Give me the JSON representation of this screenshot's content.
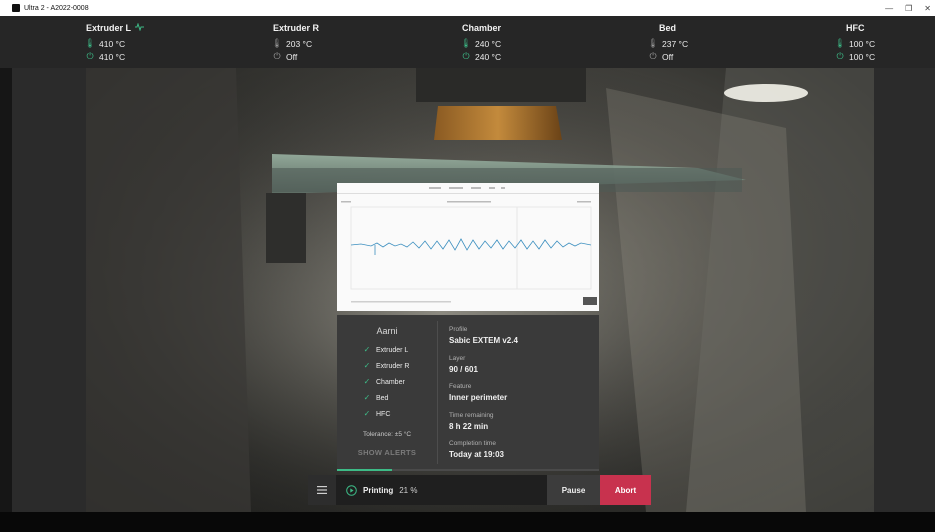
{
  "window": {
    "title": "Ultra 2 - A2022-0008",
    "controls": [
      "—",
      "❐",
      "✕"
    ]
  },
  "temps": [
    {
      "name": "Extruder L",
      "current": "410 °C",
      "target": "410 °C",
      "badge_icon": "pulse-icon"
    },
    {
      "name": "Extruder R",
      "current": "203 °C",
      "target": "Off"
    },
    {
      "name": "Chamber",
      "current": "240 °C",
      "target": "240 °C"
    },
    {
      "name": "Bed",
      "current": "237 °C",
      "target": "Off"
    },
    {
      "name": "HFC",
      "current": "100 °C",
      "target": "100 °C"
    }
  ],
  "panel": {
    "title": "Aarni",
    "checks": [
      "Extruder L",
      "Extruder R",
      "Chamber",
      "Bed",
      "HFC"
    ],
    "tolerance": "Tolerance: ±5 °C",
    "show_alerts": "SHOW ALERTS",
    "profile_label": "Profile",
    "profile_value": "Sabic EXTEM v2.4",
    "layer_label": "Layer",
    "layer_value": "90 / 601",
    "feature_label": "Feature",
    "feature_value": "Inner perimeter",
    "time_remaining_label": "Time remaining",
    "time_remaining_value": "8 h 22 min",
    "completion_label": "Completion time",
    "completion_value": "Today at 19:03"
  },
  "controls": {
    "status_label": "Printing",
    "progress_text": "21 %",
    "progress": 0.21,
    "pause_label": "Pause",
    "abort_label": "Abort"
  },
  "colors": {
    "accent": "#3dbb87",
    "abort": "#c8324e",
    "topbar": "#262626",
    "panel": "#3a3a3a"
  }
}
